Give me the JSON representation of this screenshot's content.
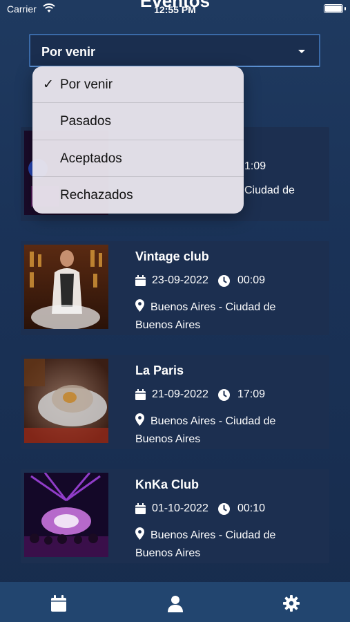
{
  "status_bar": {
    "carrier": "Carrier",
    "time": "12:55 PM"
  },
  "header": {
    "title": "Eventos"
  },
  "filter": {
    "selected": "Por venir",
    "options": [
      {
        "label": "Por venir",
        "checked": true
      },
      {
        "label": "Pasados",
        "checked": false
      },
      {
        "label": "Aceptados",
        "checked": false
      },
      {
        "label": "Rechazados",
        "checked": false
      }
    ]
  },
  "events": [
    {
      "name": "",
      "date": "",
      "time": "1:09",
      "location": "Ciudad de"
    },
    {
      "name": "Vintage club",
      "date": "23-09-2022",
      "time": "00:09",
      "location": "Buenos Aires - Ciudad de Buenos Aires"
    },
    {
      "name": "La Paris",
      "date": "21-09-2022",
      "time": "17:09",
      "location": "Buenos Aires - Ciudad de Buenos Aires"
    },
    {
      "name": "KnKa Club",
      "date": "01-10-2022",
      "time": "00:10",
      "location": "Buenos Aires - Ciudad de Buenos Aires"
    }
  ],
  "tab_bar": {
    "tabs": [
      {
        "icon": "calendar-icon"
      },
      {
        "icon": "user-icon"
      },
      {
        "icon": "gear-icon"
      }
    ]
  },
  "colors": {
    "background": "#1a3257",
    "card": "#1c2f50",
    "tab_bar": "#22456f",
    "menu": "#e8e4ec"
  }
}
